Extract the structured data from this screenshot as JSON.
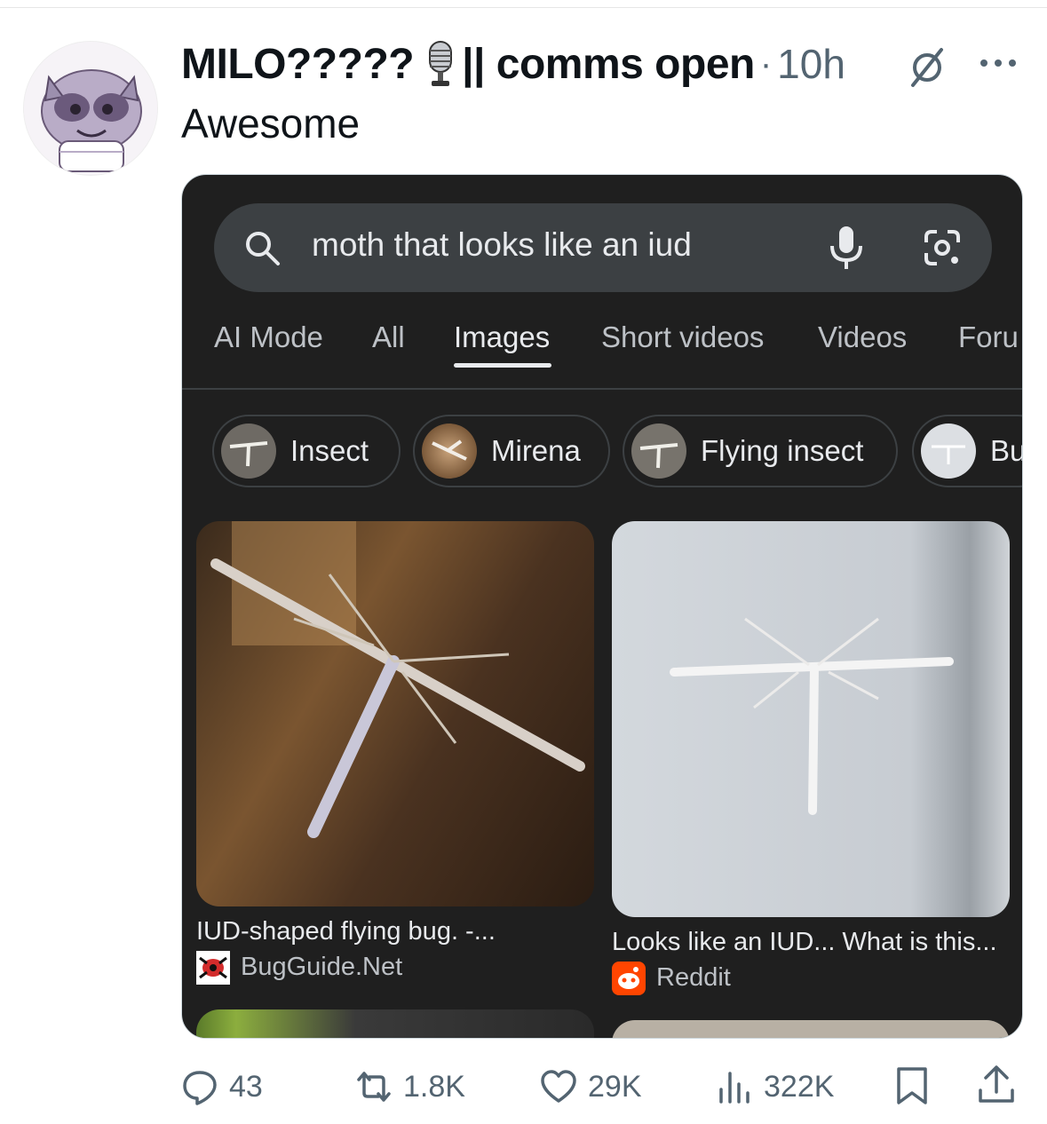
{
  "post": {
    "author_name": "MILO?????",
    "author_suffix": "|| comms open",
    "separator": "·",
    "time": "10h",
    "text": "Awesome"
  },
  "embedded_screenshot": {
    "search": {
      "query": "moth that looks like an iud"
    },
    "tabs": [
      {
        "label": "AI Mode"
      },
      {
        "label": "All"
      },
      {
        "label": "Images"
      },
      {
        "label": "Short videos"
      },
      {
        "label": "Videos"
      },
      {
        "label": "Foru"
      }
    ],
    "active_tab": "Images",
    "chips": [
      {
        "label": "Insect"
      },
      {
        "label": "Mirena"
      },
      {
        "label": "Flying insect"
      },
      {
        "label": "Bu"
      }
    ],
    "results": [
      {
        "title": "IUD-shaped flying bug. -...",
        "source": "BugGuide.Net"
      },
      {
        "title": "Looks like an IUD... What is this...",
        "source": "Reddit"
      }
    ]
  },
  "actions": {
    "replies": "43",
    "reposts": "1.8K",
    "likes": "29K",
    "views": "322K"
  },
  "colors": {
    "text_primary": "#0f1419",
    "text_secondary": "#536471",
    "google_dark_bg": "#1f1f1f",
    "google_searchbar": "#3c4043"
  },
  "icons": [
    "search-icon",
    "voice-search-icon",
    "lens-icon",
    "grok-icon",
    "more-icon",
    "reply-icon",
    "repost-icon",
    "like-icon",
    "views-icon",
    "bookmark-icon",
    "share-icon",
    "microphone-emoji"
  ]
}
